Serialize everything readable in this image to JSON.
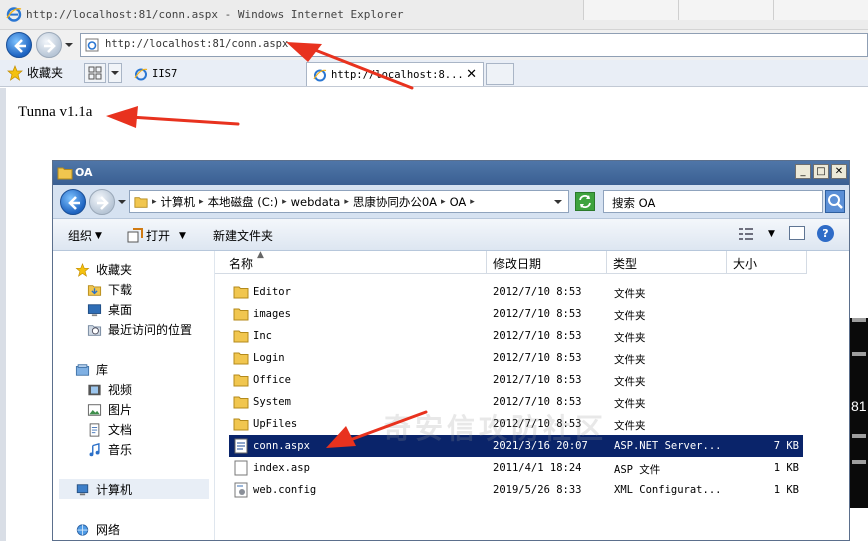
{
  "browser": {
    "title": "http://localhost:81/conn.aspx - Windows Internet Explorer",
    "address": "http://localhost:81/conn.aspx",
    "favorites_label": "收藏夹",
    "tabs": [
      {
        "label": "IIS7"
      },
      {
        "label": "http://localhost:8..."
      }
    ],
    "page_text": "Tunna v1.1a"
  },
  "explorer": {
    "title": "OA",
    "breadcrumb": [
      "计算机",
      "本地磁盘 (C:)",
      "webdata",
      "思康协同办公0A",
      "OA"
    ],
    "search_placeholder": "搜索 OA",
    "commands": {
      "organize": "组织",
      "open": "打开",
      "new_folder": "新建文件夹"
    },
    "sidebar": {
      "favorites": "收藏夹",
      "downloads": "下载",
      "desktop": "桌面",
      "recent": "最近访问的位置",
      "libraries": "库",
      "videos": "视频",
      "pictures": "图片",
      "documents": "文档",
      "music": "音乐",
      "computer": "计算机",
      "network": "网络"
    },
    "columns": {
      "name": "名称",
      "date": "修改日期",
      "type": "类型",
      "size": "大小"
    },
    "files": [
      {
        "name": "Editor",
        "date": "2012/7/10 8:53",
        "type": "文件夹",
        "size": "",
        "icon": "folder-icon"
      },
      {
        "name": "images",
        "date": "2012/7/10 8:53",
        "type": "文件夹",
        "size": "",
        "icon": "folder-icon"
      },
      {
        "name": "Inc",
        "date": "2012/7/10 8:53",
        "type": "文件夹",
        "size": "",
        "icon": "folder-icon"
      },
      {
        "name": "Login",
        "date": "2012/7/10 8:53",
        "type": "文件夹",
        "size": "",
        "icon": "folder-icon"
      },
      {
        "name": "Office",
        "date": "2012/7/10 8:53",
        "type": "文件夹",
        "size": "",
        "icon": "folder-icon"
      },
      {
        "name": "System",
        "date": "2012/7/10 8:53",
        "type": "文件夹",
        "size": "",
        "icon": "folder-icon"
      },
      {
        "name": "UpFiles",
        "date": "2012/7/10 8:53",
        "type": "文件夹",
        "size": "",
        "icon": "folder-icon"
      },
      {
        "name": "conn.aspx",
        "date": "2021/3/16 20:07",
        "type": "ASP.NET Server...",
        "size": "7 KB",
        "icon": "aspx-file-icon",
        "selected": true
      },
      {
        "name": "index.asp",
        "date": "2011/4/1 18:24",
        "type": "ASP 文件",
        "size": "1 KB",
        "icon": "asp-file-icon"
      },
      {
        "name": "web.config",
        "date": "2019/5/26 8:33",
        "type": "XML Configurat...",
        "size": "1 KB",
        "icon": "config-file-icon"
      }
    ]
  },
  "watermark": "奇安信攻防社区",
  "overlay": {
    "side_number": "81"
  },
  "colors": {
    "selection": "#0a246a",
    "annotation_arrow": "#e8321e",
    "explorer_title": "#3a5f92"
  }
}
